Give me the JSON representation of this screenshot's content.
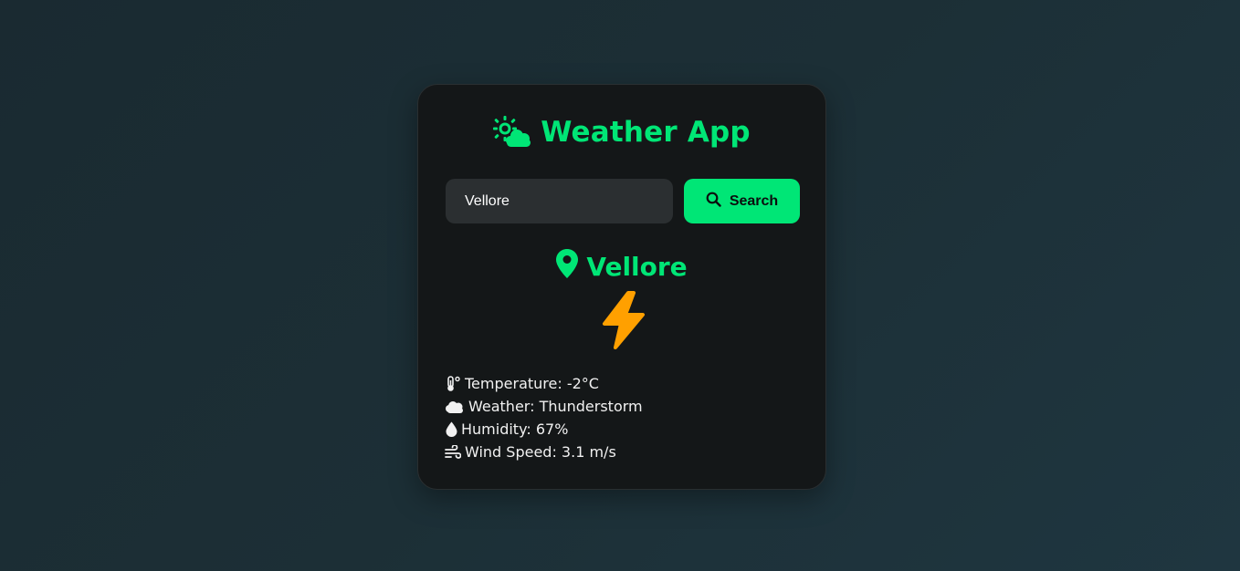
{
  "app": {
    "title": "Weather App",
    "title_icon": "sun-cloud-icon",
    "accent_color": "#00e676"
  },
  "search": {
    "value": "Vellore",
    "placeholder": "Enter city name",
    "button_label": "Search",
    "button_icon": "search-icon"
  },
  "result": {
    "city": "Vellore",
    "location_icon": "map-pin-icon",
    "weather_icon": "lightning-bolt-icon",
    "weather_icon_color": "#ffa000",
    "details": {
      "temperature": "Temperature: -2°C",
      "weather": "Weather: Thunderstorm",
      "humidity": "Humidity: 67%",
      "wind": "Wind Speed: 3.1 m/s"
    }
  }
}
